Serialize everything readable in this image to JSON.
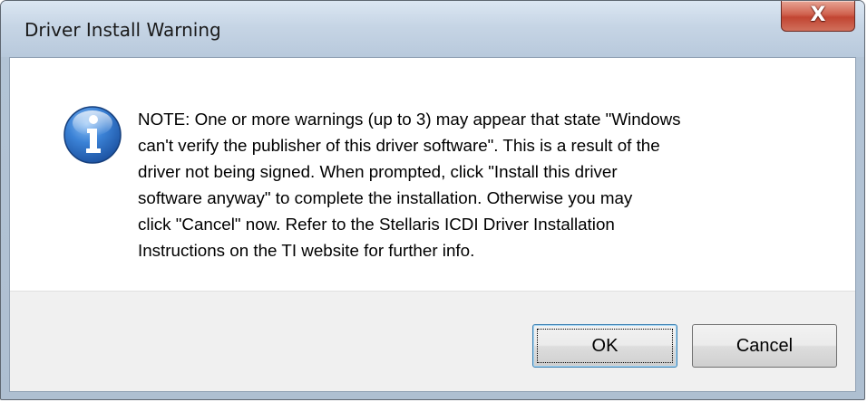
{
  "window": {
    "title": "Driver Install Warning",
    "close_glyph": "X"
  },
  "dialog": {
    "icon": "info-icon",
    "message": "NOTE: One or more warnings (up to 3) may appear that state \"Windows can't verify the publisher of this driver software\".  This is a result of the driver not being signed.  When prompted, click \"Install this driver software anyway\" to complete the installation.  Otherwise you may click \"Cancel\" now.  Refer to the Stellaris ICDI Driver Installation Instructions on the TI website for further info.",
    "message_lines": [
      "NOTE: One or more warnings (up to 3) may appear that state \"Windows",
      "can't verify the publisher of this driver software\".  This is a result of the",
      "driver not being signed.  When prompted, click \"Install this driver",
      "software anyway\" to complete the installation.  Otherwise you may",
      "click \"Cancel\" now.  Refer to the Stellaris ICDI Driver Installation",
      "Instructions on the TI website for further info."
    ]
  },
  "buttons": {
    "ok_label": "OK",
    "cancel_label": "Cancel"
  },
  "colors": {
    "titlebar": "#c6d5e5",
    "close_button": "#c24532",
    "info_icon": "#2a6fc9",
    "footer": "#f0f0f0"
  }
}
